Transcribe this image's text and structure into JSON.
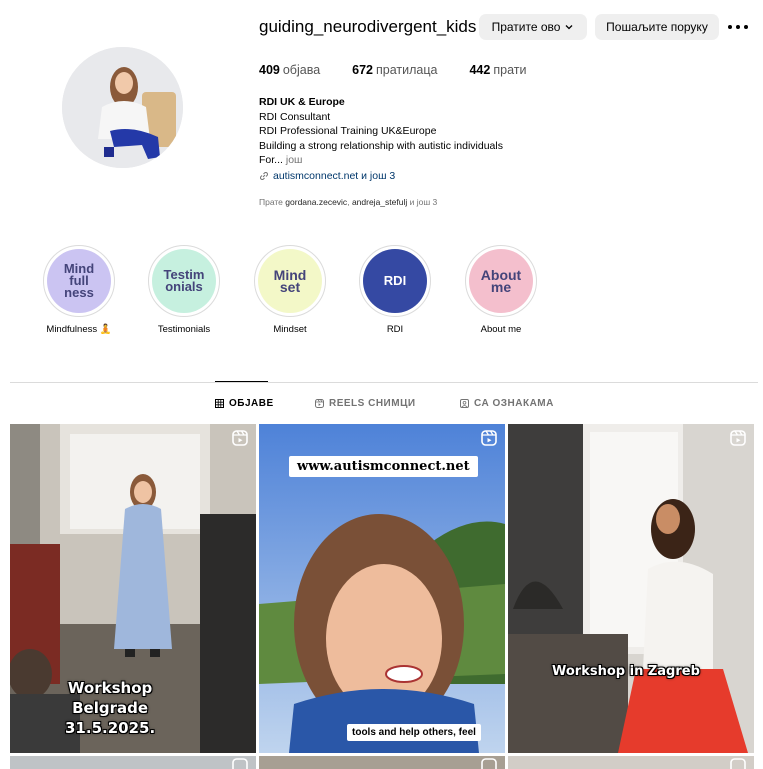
{
  "profile": {
    "username": "guiding_neurodivergent_kids",
    "follow_button": "Пратите ово",
    "message_button": "Пошаљите поруку",
    "stats": [
      {
        "count": "409",
        "label": "објава"
      },
      {
        "count": "672",
        "label": "пратилаца"
      },
      {
        "count": "442",
        "label": "прати"
      }
    ],
    "bio": {
      "name": "RDI UK & Europe",
      "line1": "RDI Consultant",
      "line2": "RDI Professional Training UK&Europe",
      "line3": "Building a strong relationship with autistic individuals",
      "line4": "For...",
      "more": "још",
      "link": "autismconnect.net и још 3"
    },
    "followed_by": {
      "prefix": "Прате",
      "name1": "gordana.zecevic",
      "sep": ",",
      "name2": "andreja_stefulj",
      "suffix": "и још 3"
    }
  },
  "highlights": [
    {
      "label": "Mindfulness 🧘",
      "cover_text": "Mind full ness",
      "color": "#cbc4f2"
    },
    {
      "label": "Testimonials",
      "cover_text": "Testim onials",
      "color": "#c6f0df"
    },
    {
      "label": "Mindset",
      "cover_text": "Mind set",
      "color": "#f3f8c8"
    },
    {
      "label": "RDI",
      "cover_text": "RDI",
      "color": "#3549a3"
    },
    {
      "label": "About me",
      "cover_text": "About me",
      "color": "#f4bfcd"
    }
  ],
  "tabs": [
    {
      "label": "ОБЈАВЕ",
      "icon": "grid-icon",
      "active": true
    },
    {
      "label": "REELS СНИМЦИ",
      "icon": "reels-icon",
      "active": false
    },
    {
      "label": "СА ОЗНАКАМА",
      "icon": "tagged-icon",
      "active": false
    }
  ],
  "posts": [
    {
      "caption_line1": "Workshop",
      "caption_line2": "Belgrade",
      "caption_line3": "31.5.2025."
    },
    {
      "banner": "www.autismconnect.net",
      "subtitle": "tools and help others, feel"
    },
    {
      "caption": "Workshop in Zagreb"
    }
  ],
  "colors": {
    "button_bg": "#efefef",
    "link": "#00376b",
    "muted": "#737373"
  }
}
